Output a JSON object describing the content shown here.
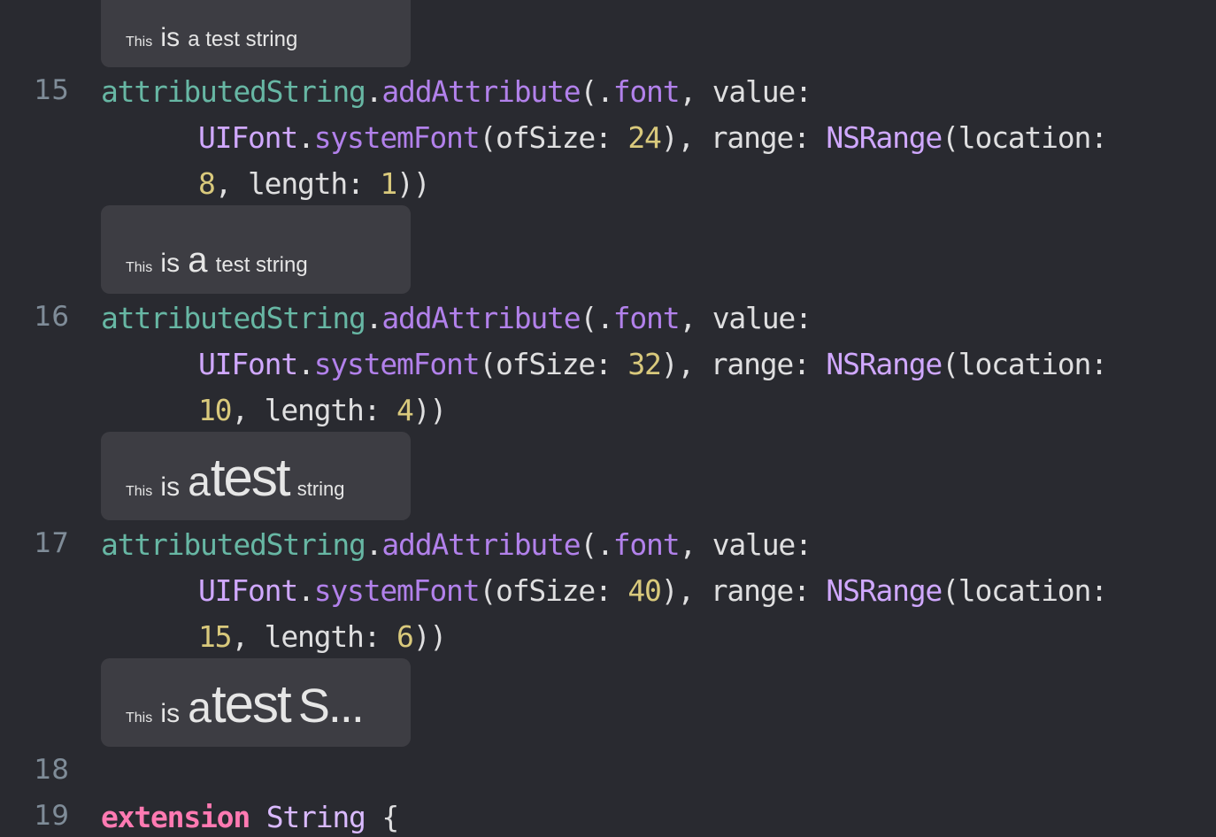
{
  "gutter": {
    "line15": "15",
    "line16": "16",
    "line17": "17",
    "line18": "18",
    "line19": "19"
  },
  "previews": {
    "p0": {
      "w1": "This",
      "w2": "is",
      "w3": "a test string"
    },
    "p1": {
      "w1": "This",
      "w2": "is",
      "w3": "a",
      "w4": "test string"
    },
    "p2": {
      "w1": "This",
      "w2": "is",
      "w3": "a",
      "w4": "test",
      "w5": "string"
    },
    "p3": {
      "w1": "This",
      "w2": "is",
      "w3": "a",
      "w4": "test",
      "w5": "S..."
    }
  },
  "code": {
    "l15": {
      "ident": "attributedString",
      "dot1": ".",
      "method": "addAttribute",
      "paren": "(.",
      "font": "font",
      "rest1": ", value:",
      "uifont": "UIFont",
      "dot2": ".",
      "sysfont": "systemFont",
      "ofsize": "(ofSize: ",
      "size": "24",
      "range": "), range: ",
      "nsrange": "NSRange",
      "loc": "(location:",
      "locval": "8",
      "len": ", length: ",
      "lenval": "1",
      "close": "))"
    },
    "l16": {
      "ident": "attributedString",
      "dot1": ".",
      "method": "addAttribute",
      "paren": "(.",
      "font": "font",
      "rest1": ", value:",
      "uifont": "UIFont",
      "dot2": ".",
      "sysfont": "systemFont",
      "ofsize": "(ofSize: ",
      "size": "32",
      "range": "), range: ",
      "nsrange": "NSRange",
      "loc": "(location:",
      "locval": "10",
      "len": ", length: ",
      "lenval": "4",
      "close": "))"
    },
    "l17": {
      "ident": "attributedString",
      "dot1": ".",
      "method": "addAttribute",
      "paren": "(.",
      "font": "font",
      "rest1": ", value:",
      "uifont": "UIFont",
      "dot2": ".",
      "sysfont": "systemFont",
      "ofsize": "(ofSize: ",
      "size": "40",
      "range": "), range: ",
      "nsrange": "NSRange",
      "loc": "(location:",
      "locval": "15",
      "len": ", length: ",
      "lenval": "6",
      "close": "))"
    },
    "l19": {
      "kw": "extension",
      "type": "String",
      "brace": "{"
    }
  },
  "colors": {
    "background": "#292a30",
    "preview_bg": "#3d3d43",
    "identifier": "#67b7a4",
    "method": "#a167e6",
    "type": "#d0a8ff",
    "number": "#d9c97c",
    "keyword": "#ff7ab2",
    "line_number": "#7f8c98"
  }
}
